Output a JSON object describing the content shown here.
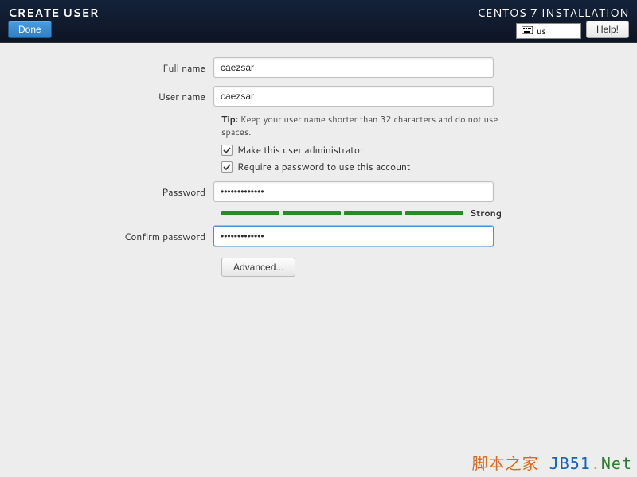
{
  "header": {
    "title_left": "CREATE USER",
    "title_right": "CENTOS 7 INSTALLATION",
    "done_label": "Done",
    "help_label": "Help!",
    "keyboard_layout": "us"
  },
  "form": {
    "full_name": {
      "label": "Full name",
      "value": "caezsar"
    },
    "user_name": {
      "label": "User name",
      "value": "caezsar"
    },
    "tip_prefix": "Tip:",
    "tip_text": " Keep your user name shorter than 32 characters and do not use spaces.",
    "make_admin": {
      "label": "Make this user administrator",
      "checked": true
    },
    "require_pw": {
      "label": "Require a password to use this account",
      "checked": true
    },
    "password": {
      "label": "Password",
      "value": "•••••••••••••"
    },
    "password_strength": "Strong",
    "confirm_password": {
      "label": "Confirm password",
      "value": "•••••••••••••"
    },
    "advanced_label": "Advanced..."
  },
  "watermark": {
    "cn": "脚本之家",
    "en1": "JB51",
    "dot": ".",
    "en2": "Net"
  }
}
